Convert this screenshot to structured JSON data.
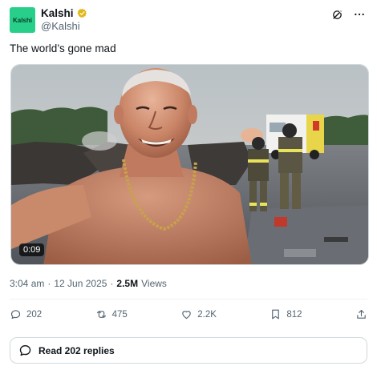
{
  "header": {
    "avatar_text": "Kalshi",
    "name": "Kalshi",
    "handle": "@Kalshi"
  },
  "post": {
    "text": "The world’s gone mad",
    "video_duration": "0:09",
    "time": "3:04 am",
    "separator": "·",
    "date": "12 Jun 2025",
    "views_count": "2.5M",
    "views_label": "Views"
  },
  "actions": {
    "replies": "202",
    "reposts": "475",
    "likes": "2.2K",
    "bookmarks": "812"
  },
  "read_replies_label": "Read 202 replies",
  "colors": {
    "avatar_bg": "#28cf8a",
    "verified_badge": "#e2b719",
    "text_secondary": "#536471"
  }
}
